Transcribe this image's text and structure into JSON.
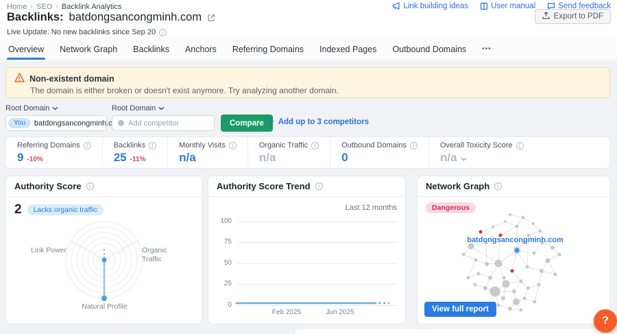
{
  "breadcrumb": {
    "items": [
      "Home",
      "SEO",
      "Backlink Analytics"
    ]
  },
  "header": {
    "links": [
      {
        "label": "Link building ideas"
      },
      {
        "label": "User manual"
      },
      {
        "label": "Send feedback"
      }
    ],
    "title_prefix": "Backlinks:",
    "title_domain": "batdongsancongminh.com",
    "live_update": "Live Update: No new backlinks since Sep 20",
    "export_label": "Export to PDF"
  },
  "tabs": {
    "items": [
      "Overview",
      "Network Graph",
      "Backlinks",
      "Anchors",
      "Referring Domains",
      "Indexed Pages",
      "Outbound Domains"
    ],
    "active": "Overview",
    "more": "•••"
  },
  "banner": {
    "title": "Non-existent domain",
    "description": "The domain is either broken or doesn't exist anymore. Try analyzing another domain."
  },
  "compare_bar": {
    "main_selector_label": "Root Domain",
    "competitor_selector_label": "Root Domain",
    "you_badge": "You",
    "main_domain": "batdongsancongminh.com",
    "competitor_placeholder": "Add competitor",
    "compare_button": "Compare",
    "add_competitors_link": "Add up to 3 competitors"
  },
  "metrics": [
    {
      "label": "Referring Domains",
      "value": "9",
      "change": "-10%"
    },
    {
      "label": "Backlinks",
      "value": "25",
      "change": "-11%"
    },
    {
      "label": "Monthly Visits",
      "value": "n/a"
    },
    {
      "label": "Organic Traffic",
      "value": "n/a"
    },
    {
      "label": "Outbound Domains",
      "value": "0"
    },
    {
      "label": "Overall Toxicity Score",
      "value": "n/a"
    }
  ],
  "authority_score": {
    "title": "Authority Score",
    "value": "2",
    "badge": "Lacks organic traffic",
    "axis_labels": [
      "Link Power",
      "Organic Traffic",
      "Natural Profile"
    ]
  },
  "trend": {
    "title": "Authority Score Trend",
    "period": "Last 12 months",
    "yticks": [
      "100",
      "75",
      "50",
      "25",
      "0"
    ],
    "xticks": [
      "Feb 2025",
      "Jun 2025"
    ],
    "chart_data": {
      "type": "line",
      "x_labels": [
        "Feb 2025",
        "Jun 2025"
      ],
      "series": [
        {
          "name": "Authority Score",
          "values": [
            2,
            2,
            2,
            2,
            2,
            2,
            2,
            2,
            2,
            2,
            2,
            2
          ]
        }
      ],
      "ylim": [
        0,
        100
      ],
      "grid": true,
      "note": "flat line at ~2, dashed projection at right end"
    }
  },
  "network_graph": {
    "title": "Network Graph",
    "badge": "Dangerous",
    "domain_label": "batdongsancongminh.com",
    "button": "View full report"
  },
  "help_button": "?",
  "colors": {
    "accent_blue": "#2f7cd4",
    "link_blue": "#2e6fdb",
    "compare_green": "#199c68",
    "change_red": "#d6455c",
    "danger_badge_text": "#cd2c55",
    "help_orange": "#f75c28",
    "banner_bg": "#fcf5e0",
    "trend_line": "#68aede"
  }
}
